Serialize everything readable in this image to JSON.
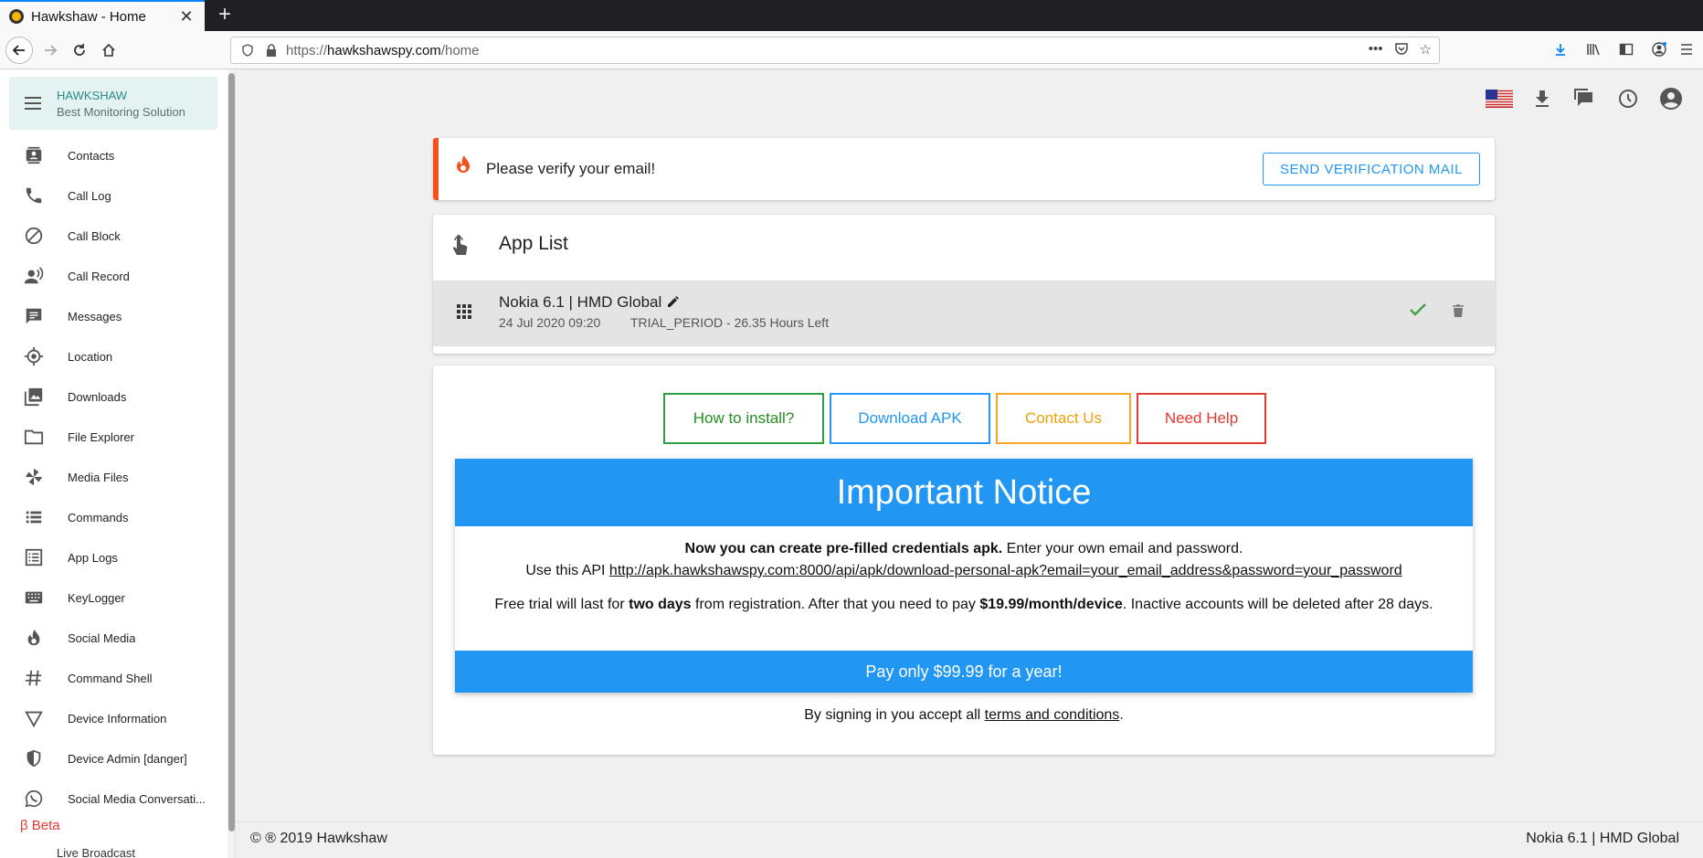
{
  "browser": {
    "tab_title": "Hawkshaw - Home",
    "url_prefix": "https://",
    "url_host": "hawkshawspy.com",
    "url_path": "/home"
  },
  "sidebar": {
    "brand_title": "HAWKSHAW",
    "brand_subtitle": "Best Monitoring Solution",
    "items": [
      {
        "label": "Contacts",
        "icon": "contacts-icon"
      },
      {
        "label": "Call Log",
        "icon": "phone-icon"
      },
      {
        "label": "Call Block",
        "icon": "block-icon"
      },
      {
        "label": "Call Record",
        "icon": "record-voice-icon"
      },
      {
        "label": "Messages",
        "icon": "message-icon"
      },
      {
        "label": "Location",
        "icon": "location-icon"
      },
      {
        "label": "Downloads",
        "icon": "photo-library-icon"
      },
      {
        "label": "File Explorer",
        "icon": "folder-icon"
      },
      {
        "label": "Media Files",
        "icon": "pinwheel-icon"
      },
      {
        "label": "Commands",
        "icon": "list-icon"
      },
      {
        "label": "App Logs",
        "icon": "checklist-icon"
      },
      {
        "label": "KeyLogger",
        "icon": "keyboard-icon"
      },
      {
        "label": "Social Media",
        "icon": "flame-icon"
      },
      {
        "label": "Command Shell",
        "icon": "hash-icon"
      },
      {
        "label": "Device Information",
        "icon": "triangle-icon"
      },
      {
        "label": "Device Admin [danger]",
        "icon": "shield-icon"
      },
      {
        "label": "Social Media Conversati...",
        "icon": "whatsapp-icon"
      }
    ],
    "beta_label": "β Beta",
    "partial_item": "Live Broadcast"
  },
  "verify": {
    "text": "Please verify your email!",
    "button": "SEND VERIFICATION MAIL"
  },
  "app_list": {
    "title": "App List",
    "device": {
      "name": "Nokia 6.1 | HMD Global",
      "date": "24 Jul 2020 09:20",
      "trial": "TRIAL_PERIOD - 26.35 Hours Left"
    }
  },
  "buttons": {
    "install": "How to install?",
    "download": "Download APK",
    "contact": "Contact Us",
    "help": "Need Help"
  },
  "notice": {
    "title": "Important Notice",
    "line1_bold": "Now you can create pre-filled credentials apk.",
    "line1_rest": " Enter your own email and password.",
    "line2_prefix": "Use this API ",
    "line2_link": "http://apk.hawkshawspy.com:8000/api/apk/download-personal-apk?email=your_email_address&password=your_password",
    "line3_a": "Free trial will last for ",
    "line3_b": "two days",
    "line3_c": " from registration. After that you need to pay ",
    "line3_d": "$19.99/month/device",
    "line3_e": ". Inactive accounts will be deleted after 28 days.",
    "pay_button": "Pay only $99.99 for a year!",
    "terms_prefix": "By signing in you accept all ",
    "terms_link": "terms and conditions",
    "terms_suffix": "."
  },
  "footer": {
    "left": "© ® 2019 Hawkshaw",
    "right": "Nokia 6.1 | HMD Global"
  },
  "colors": {
    "accent_blue": "#2196f3",
    "warning_orange": "#f4511e",
    "success_green": "#43a047",
    "danger_red": "#e53935",
    "brand_teal": "#2a8a8a"
  }
}
